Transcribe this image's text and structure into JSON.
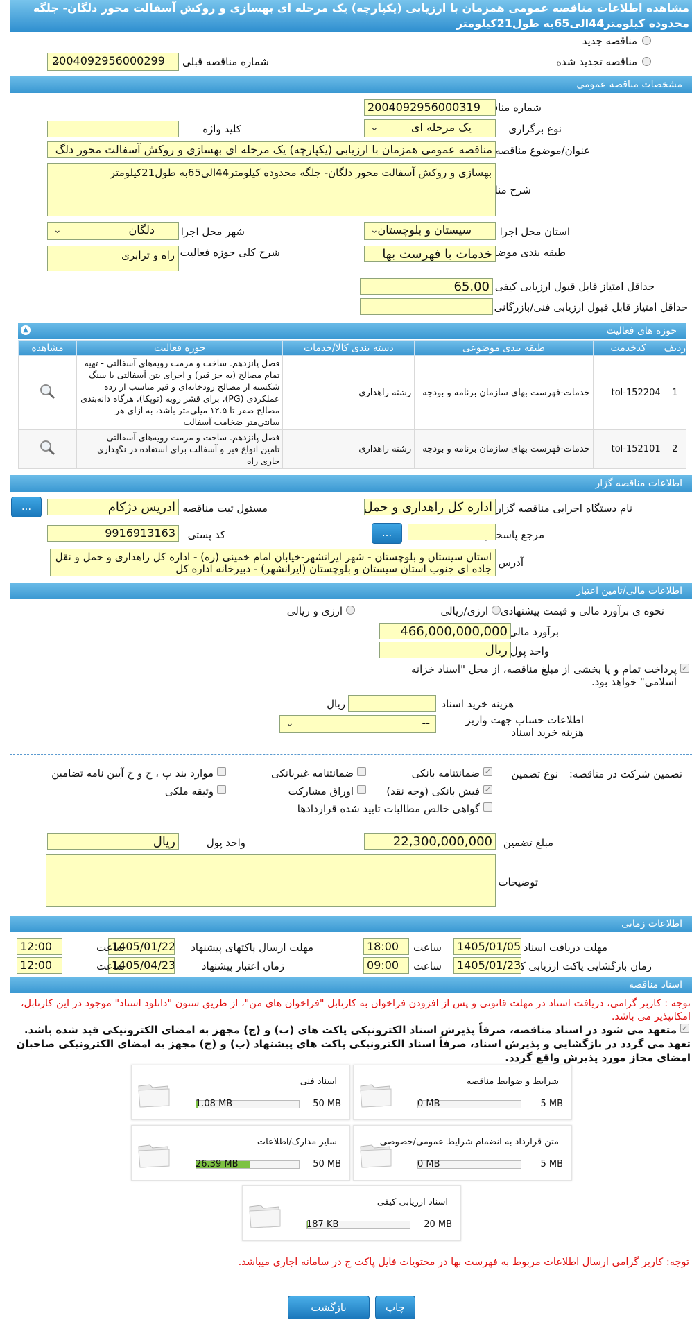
{
  "header": {
    "title": "مشاهده اطلاعات مناقصه عمومی همزمان با ارزیابی (یکپارچه) یک مرحله ای بهسازی و روکش آسفالت محور دلگان- جلگه محدوده کیلومتر44الی65به طول21کیلومتر"
  },
  "top": {
    "radio_new": "مناقصه جدید",
    "radio_renewed": "مناقصه تجدید شده",
    "prev_label": "شماره مناقصه قبلی",
    "prev_value": "2004092956000299"
  },
  "general": {
    "section": "مشخصات مناقصه عمومی",
    "number_label": "شماره مناقصه",
    "number_value": "2004092956000319",
    "type_label": "نوع برگزاری",
    "type_value": "یک مرحله ای",
    "keyword_label": "کلید واژه",
    "keyword_value": "",
    "subject_label": "عنوان/موضوع مناقصه",
    "subject_value": "مناقصه عمومی همزمان با ارزیابی (یکپارچه) یک مرحله ای بهسازی و روکش آسفالت محور دلگ",
    "desc_label": "شرح مناقصه",
    "desc_value": "بهسازی و روکش آسفالت محور دلگان- جلگه محدوده کیلومتر44الی65به طول21کیلومتر",
    "province_label": "استان محل اجرا",
    "province_value": "سیستان و بلوچستان",
    "city_label": "شهر محل اجرا",
    "city_value": "دلگان",
    "category_label": "طبقه بندی موضوعی",
    "category_value": "خدمات با فهرست بها",
    "scope_label": "شرح کلی حوزه فعالیت",
    "scope_value": "راه و ترابری",
    "quality_label": "حداقل امتیاز قابل قبول ارزیابی کیفی",
    "quality_value": "65.00",
    "tech_label": "حداقل امتیاز قابل قبول ارزیابی فنی/بازرگانی",
    "tech_value": ""
  },
  "activities": {
    "section": "حوزه های فعالیت",
    "headers": [
      "ردیف",
      "کدخدمت",
      "طبقه بندی موضوعی",
      "دسته بندی کالا/خدمات",
      "حوزه فعالیت",
      "مشاهده"
    ],
    "rows": [
      {
        "row": "1",
        "code": "tol-152204",
        "category": "خدمات-فهرست بهای سازمان برنامه و بودجه",
        "group": "رشته راهداری",
        "activity": "فصل پانزدهم. ساخت و مرمت رویه‌های آسفالتی - تهیه تمام مصالح (به جز قیر) و اجرای بتن آسفالتی با سنگ شکسته از مصالح رودخانه‌ای و قیر مناسب از رده عملکردی (PG)، برای قشر رویه (توپکا)، هرگاه دانه‌بندی مصالح صفر تا ۱۲.۵ میلی‌متر باشد، به ازای هر سانتی‌متر ضخامت آسفالت"
      },
      {
        "row": "2",
        "code": "tol-152101",
        "category": "خدمات-فهرست بهای سازمان برنامه و بودجه",
        "group": "رشته راهداری",
        "activity": "فصل پانزدهم. ساخت و مرمت رویه‌های آسفالتی - تامین انواع قیر و آسفالت برای استفاده در نگهداری جاری راه"
      }
    ]
  },
  "organizer": {
    "section": "اطلاعات مناقصه گزار",
    "device_label": "نام دستگاه اجرایی مناقصه گزار",
    "device_value": "اداره کل راهداری و حمل و ن",
    "responsible_label": "مسئول ثبت مناقصه",
    "responsible_value": "ادریس دژکام",
    "ref_label": "مرجع پاسخگویی",
    "ref_value": "",
    "postal_label": "کد پستی",
    "postal_value": "9916913163",
    "address_label": "آدرس",
    "address_value": "استان سیستان و بلوچستان - شهر ایرانشهر-خیابان امام خمینی (ره) - اداره کل راهداری و حمل و نقل جاده ای جنوب استان سیستان و بلوچستان (ایرانشهر) - دبیرخانه اداره کل",
    "more_button": "..."
  },
  "finance": {
    "section": "اطلاعات مالی/تامین اعتبار",
    "method_label": "نحوه ی برآورد مالی و قیمت پیشنهادی",
    "opt_rial": "ارزی/ریالی",
    "opt_fx": "ارزی و ریالی",
    "estimate_label": "برآورد مالی",
    "estimate_value": "466,000,000,000",
    "currency_label": "واحد پول",
    "currency_value": "ریال",
    "treasury_text": "پرداخت تمام و یا بخشی از مبلغ مناقصه، از محل \"اسناد خزانه اسلامی\" خواهد بود.",
    "doccost_label": "هزینه خرید اسناد",
    "doccost_unit": "ریال",
    "account_label": "اطلاعات حساب جهت واریز هزینه خرید اسناد",
    "account_value": "--"
  },
  "guarantee": {
    "participate_label": "تضمین شرکت در مناقصه:",
    "type_label": "نوع تضمین",
    "bank": "ضمانتنامه بانکی",
    "nonbank": "ضمانتنامه غیربانکی",
    "clauses": "موارد بند پ ، ح و خ آیین نامه تضامین",
    "cash": "فیش بانکی (وجه نقد)",
    "bonds": "اوراق مشارکت",
    "property": "وثیقه ملکی",
    "claims": "گواهی خالص مطالبات تایید شده قراردادها",
    "amount_label": "مبلغ تضمین",
    "amount_value": "22,300,000,000",
    "unit_label": "واحد پول",
    "unit_value": "ریال",
    "notes_label": "توضیحات",
    "notes_value": ""
  },
  "timing": {
    "section": "اطلاعات زمانی",
    "receive_label": "مهلت دریافت اسناد",
    "receive_date": "1405/01/05",
    "receive_time": "18:00",
    "send_label": "مهلت ارسال پاکتهای پیشنهاد",
    "send_date": "1405/01/22",
    "send_time": "12:00",
    "open_label": "زمان بازگشایی پاکت ارزیابی کیفی",
    "open_date": "1405/01/23",
    "open_time": "09:00",
    "valid_label": "زمان اعتبار پیشنهاد",
    "valid_date": "1405/04/23",
    "valid_time": "12:00",
    "time_word": "ساعت"
  },
  "documents": {
    "section": "اسناد مناقصه",
    "note1": "توجه : کاربر گرامی، دریافت اسناد در مهلت قانونی و پس از افزودن فراخوان به کارتابل \"فراخوان های من\"، از طریق ستون \"دانلود اسناد\" موجود در این کارتابل، امکانپذیر می باشد.",
    "pledge": "متعهد می شود در اسناد مناقصه، صرفاً پذیرش اسناد الکترونیکی پاکت های (ب) و (ج) مجهز به امضای الکترونیکی قید شده باشد. تعهد می گردد در بازگشایی و پذیرش اسناد، صرفاً اسناد الکترونیکی پاکت های پیشنهاد (ب) و (ج) مجهز به امضای الکترونیکی صاحبان امضای مجاز مورد پذیرش واقع گردد.",
    "items": [
      {
        "title": "شرایط و ضوابط مناقصه",
        "current": "0 MB",
        "max": "5 MB",
        "fraction": 0
      },
      {
        "title": "اسناد فنی",
        "current": "1.08 MB",
        "max": "50 MB",
        "fraction": 0.022
      },
      {
        "title": "متن قرارداد به انضمام شرایط عمومی/خصوصی",
        "current": "0 MB",
        "max": "5 MB",
        "fraction": 0
      },
      {
        "title": "سایر مدارک/اطلاعات",
        "current": "26.39 MB",
        "max": "50 MB",
        "fraction": 0.528
      },
      {
        "title": "اسناد ارزیابی کیفی",
        "current": "187 KB",
        "max": "20 MB",
        "fraction": 0.009
      }
    ],
    "note2": "توجه: کاربر گرامی ارسال اطلاعات مربوط به فهرست بها در محتویات فایل پاکت ج در سامانه اجاری میباشد."
  },
  "footer": {
    "back": "بازگشت",
    "print": "چاپ"
  },
  "colors": {
    "bar": "#3a98d2",
    "field": "#ffffc0",
    "red": "#e01010",
    "progress": "#7dc242"
  }
}
